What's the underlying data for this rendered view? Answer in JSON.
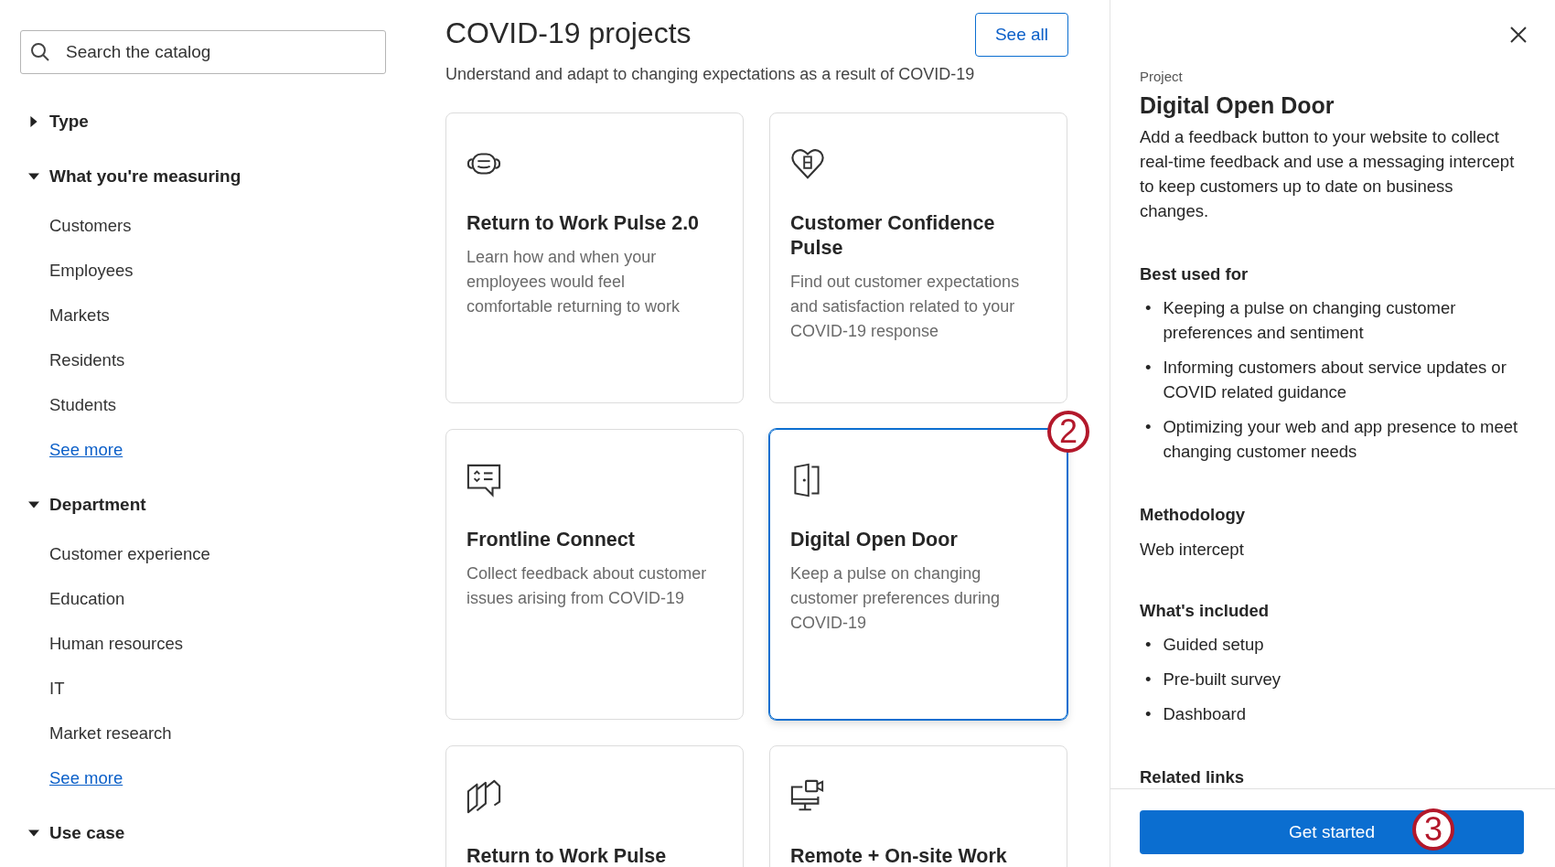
{
  "sidebar": {
    "search": {
      "placeholder": "Search the catalog"
    },
    "filters": [
      {
        "label": "Type",
        "expanded": false
      },
      {
        "label": "What you're measuring",
        "expanded": true,
        "items": [
          "Customers",
          "Employees",
          "Markets",
          "Residents",
          "Students"
        ],
        "see_more": "See more"
      },
      {
        "label": "Department",
        "expanded": true,
        "items": [
          "Customer experience",
          "Education",
          "Human resources",
          "IT",
          "Market research"
        ],
        "see_more": "See more"
      },
      {
        "label": "Use case",
        "expanded": true
      }
    ]
  },
  "section": {
    "title": "COVID-19 projects",
    "subtitle": "Understand and adapt to changing expectations as a result of COVID-19",
    "see_all": "See all"
  },
  "cards": [
    {
      "title": "Return to Work Pulse 2.0",
      "description": "Learn how and when your employees would feel comfortable returning to work",
      "selected": false
    },
    {
      "title": "Customer Confidence Pulse",
      "description": "Find out customer expectations and satisfaction related to your COVID-19 response",
      "selected": false
    },
    {
      "title": "Frontline Connect",
      "description": "Collect feedback about customer issues arising from COVID-19",
      "selected": false
    },
    {
      "title": "Digital Open Door",
      "description": "Keep a pulse on changing customer preferences during COVID-19",
      "selected": true
    },
    {
      "title": "Return to Work Pulse",
      "selected": false
    },
    {
      "title": "Remote + On-site Work",
      "selected": false
    }
  ],
  "detail": {
    "eyebrow": "Project",
    "title": "Digital Open Door",
    "description": "Add a feedback button to your website to collect real-time feedback and use a messaging intercept to keep customers up to date on business changes.",
    "sections": [
      {
        "heading": "Best used for",
        "kind": "list",
        "bullet": "•",
        "items": [
          "Keeping a pulse on changing customer preferences and sentiment",
          "Informing customers about service updates or COVID related guidance",
          "Optimizing your web and app presence to meet changing customer needs"
        ]
      },
      {
        "heading": "Methodology",
        "kind": "text",
        "text": "Web intercept"
      },
      {
        "heading": "What's included",
        "kind": "list",
        "bullet": "•",
        "items": [
          "Guided setup",
          "Pre-built survey",
          "Dashboard"
        ]
      },
      {
        "heading": "Related links",
        "kind": "heading"
      }
    ],
    "button": {
      "label": "Get started"
    }
  },
  "step_markers": [
    "2",
    "3"
  ]
}
